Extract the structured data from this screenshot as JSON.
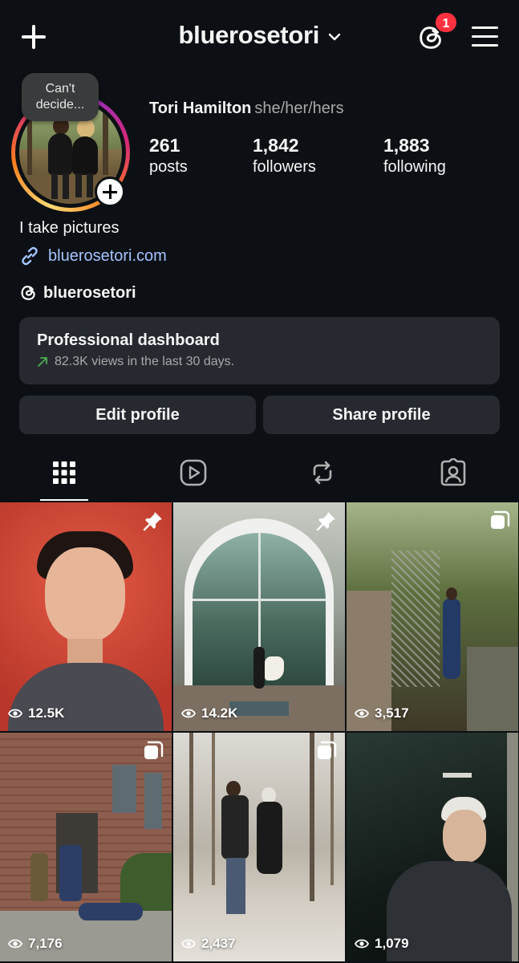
{
  "header": {
    "username": "bluerosetori",
    "notification_count": "1"
  },
  "profile": {
    "note": "Can't decide...",
    "full_name": "Tori Hamilton",
    "pronouns": "she/her/hers",
    "stats": [
      {
        "value": "261",
        "label": "posts"
      },
      {
        "value": "1,842",
        "label": "followers"
      },
      {
        "value": "1,883",
        "label": "following"
      }
    ],
    "bio": "I take pictures",
    "link": "bluerosetori.com",
    "threads_handle": "bluerosetori"
  },
  "dashboard": {
    "title": "Professional dashboard",
    "subtitle": "82.3K views in the last 30 days."
  },
  "buttons": {
    "edit": "Edit profile",
    "share": "Share profile"
  },
  "tabs": [
    {
      "icon": "grid-icon",
      "active": true
    },
    {
      "icon": "reels-icon",
      "active": false
    },
    {
      "icon": "reposts-icon",
      "active": false
    },
    {
      "icon": "tagged-icon",
      "active": false
    }
  ],
  "posts": [
    {
      "views": "12.5K",
      "badge": "pin-icon"
    },
    {
      "views": "14.2K",
      "badge": "pin-icon"
    },
    {
      "views": "3,517",
      "badge": "carousel-icon"
    },
    {
      "views": "7,176",
      "badge": "carousel-icon"
    },
    {
      "views": "2,437",
      "badge": "carousel-icon"
    },
    {
      "views": "1,079",
      "badge": ""
    }
  ],
  "colors": {
    "background": "#0c1014",
    "card": "#262a30",
    "link": "#a5c4ff",
    "badge_red": "#ff3040",
    "trend_green": "#4caf50"
  }
}
